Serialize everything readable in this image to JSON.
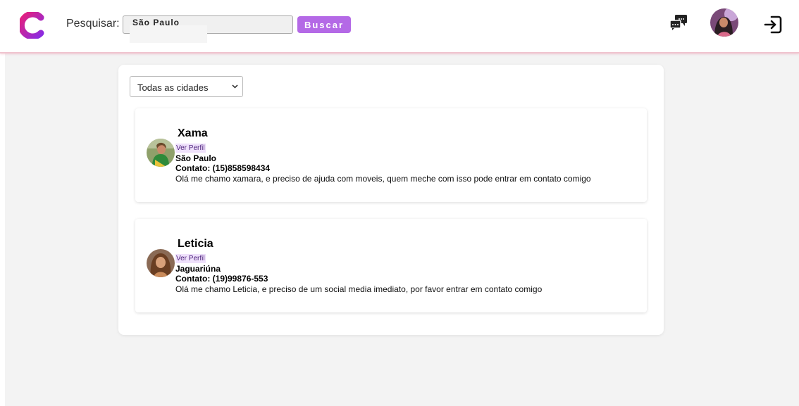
{
  "header": {
    "search_label": "Pesquisar:",
    "search_value": "São Paulo",
    "search_button": "Buscar",
    "logo_icon": "logo-c-icon",
    "chat_icon": "chat-bubbles-icon",
    "logout_icon": "logout-icon"
  },
  "filter": {
    "selected": "Todas as cidades"
  },
  "posts": [
    {
      "name": "Xama",
      "profile_link": "Ver Perfil",
      "city": "São Paulo",
      "contact": "Contato: (15)858598434",
      "message": "Olá me chamo xamara, e preciso de ajuda com moveis, quem meche com isso pode entrar em contato comigo"
    },
    {
      "name": "Leticia",
      "profile_link": "Ver Perfil",
      "city": "Jaguariúna",
      "contact": "Contato: (19)99876-553",
      "message": "Olá me chamo Leticia, e preciso de um social media imediato, por favor entrar em contato comigo"
    }
  ],
  "colors": {
    "accent": "#b469e6",
    "logo_gradient_start": "#e8207a",
    "logo_gradient_end": "#8a2be2",
    "header_border": "#f0c4cf"
  }
}
